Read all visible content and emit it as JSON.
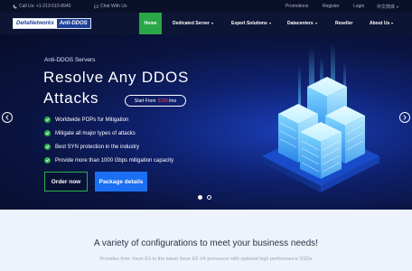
{
  "topbar": {
    "phone": "Call Us: +1-213-510-8940",
    "chat": "Chat With Us",
    "promotions": "Promotions",
    "register": "Register",
    "login": "Login",
    "language": "中文简体"
  },
  "logo": {
    "part1": "DeltaNetworks",
    "part2": "Anti-DDOS"
  },
  "nav": {
    "home": "Home",
    "dedicated": "Dedicated Server",
    "expert": "Expert Solutions",
    "datacenters": "Datacenters",
    "reseller": "Reseller",
    "about": "About Us"
  },
  "hero": {
    "kicker": "Anti-DDOS Servers",
    "headline_line1": "Resolve Any DDOS",
    "headline_line2": "Attacks",
    "start_prefix": "Start From",
    "start_price": "$189",
    "start_suffix": "/mo",
    "features": [
      "Worldwide POPs for Mitigation",
      "Mitigate all major types of attacks",
      "Best SYN protection in the industry",
      "Provide more than 1000 Gbps mitigation capacity"
    ],
    "order_button": "Order now",
    "package_button": "Package details"
  },
  "section": {
    "title": "A variety of configurations to meet your business needs!",
    "subtitle": "Provides from Xeon E3 to the latest Xeon E5 V4 processor with optional high performance SSDs"
  },
  "colors": {
    "accent_green": "#2aa847",
    "button_blue": "#1a6ff2",
    "price_red": "#ff3b30"
  }
}
